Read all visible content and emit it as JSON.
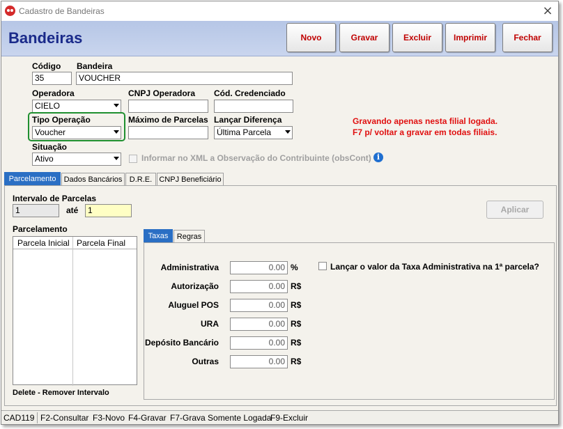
{
  "window": {
    "title": "Cadastro de Bandeiras",
    "close_glyph": "×"
  },
  "header": {
    "page_title": "Bandeiras"
  },
  "toolbar": {
    "novo": "Novo",
    "gravar": "Gravar",
    "excluir": "Excluir",
    "imprimir": "Imprimir",
    "fechar": "Fechar",
    "label_color": "#c00000"
  },
  "form": {
    "codigo": {
      "label": "Código",
      "value": "35"
    },
    "bandeira": {
      "label": "Bandeira",
      "value": "VOUCHER"
    },
    "operadora": {
      "label": "Operadora",
      "value": "CIELO"
    },
    "cnpj_operadora": {
      "label": "CNPJ Operadora",
      "value": ""
    },
    "cod_credenciado": {
      "label": "Cód. Credenciado",
      "value": ""
    },
    "tipo_operacao": {
      "label": "Tipo Operação",
      "value": "Voucher",
      "highlight_color": "#1f8f2f"
    },
    "maximo_parcelas": {
      "label": "Máximo de Parcelas",
      "value": ""
    },
    "lancar_diferenca": {
      "label": "Lançar Diferença",
      "value": "Última Parcela"
    },
    "situacao": {
      "label": "Situação",
      "value": "Ativo"
    },
    "informar_xml": {
      "label": "Informar no XML a Observação do Contribuinte (obsCont)",
      "checked": false,
      "enabled": false
    },
    "info_icon_glyph": "i",
    "warning_line1": "Gravando apenas nesta filial logada.",
    "warning_line2": "F7 p/ voltar a gravar em todas filiais.",
    "warning_color": "#e01010"
  },
  "tabs": [
    "Parcelamento",
    "Dados Bancários",
    "D.R.E.",
    "CNPJ Beneficiário"
  ],
  "parcelamento": {
    "intervalo_label": "Intervalo de Parcelas",
    "from_value": "1",
    "ate_label": "até",
    "to_value": "1",
    "aplicar_label": "Aplicar",
    "list_label": "Parcelamento",
    "columns": [
      "Parcela Inicial",
      "Parcela Final"
    ],
    "rows": [],
    "delete_hint": "Delete - Remover Intervalo"
  },
  "inner_tabs": [
    "Taxas",
    "Regras"
  ],
  "taxas": {
    "rows": [
      {
        "label": "Administrativa",
        "value": "0.00",
        "unit": "%"
      },
      {
        "label": "Autorização",
        "value": "0.00",
        "unit": "R$"
      },
      {
        "label": "Aluguel POS",
        "value": "0.00",
        "unit": "R$"
      },
      {
        "label": "URA",
        "value": "0.00",
        "unit": "R$"
      },
      {
        "label": "Depósito Bancário",
        "value": "0.00",
        "unit": "R$"
      },
      {
        "label": "Outras",
        "value": "0.00",
        "unit": "R$"
      }
    ],
    "lancar_label": "Lançar o valor da Taxa Administrativa na 1ª parcela?",
    "lancar_checked": false
  },
  "statusbar": [
    "CAD119",
    "F2-Consultar",
    "F3-Novo",
    "F4-Gravar",
    "F7-Grava Somente Logada",
    "F9-Excluir"
  ]
}
